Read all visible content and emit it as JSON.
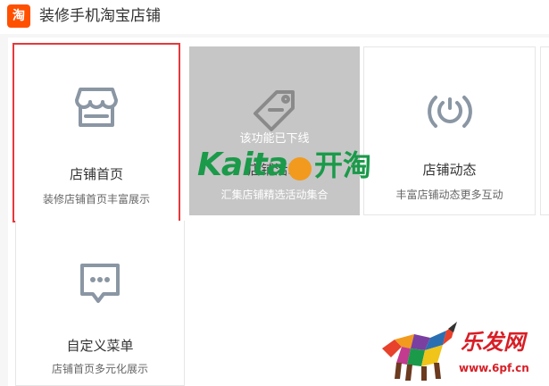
{
  "header": {
    "logo_text": "淘",
    "title": "装修手机淘宝店铺"
  },
  "tiles": [
    {
      "title": "店铺首页",
      "desc": "装修店铺首页丰富展示",
      "icon": "storefront-icon",
      "selected": true
    },
    {
      "title": "店铺活动",
      "desc": "汇集店铺精选活动集合",
      "icon": "price-tag-icon",
      "disabled": true,
      "overlay": "该功能已下线"
    },
    {
      "title": "店铺动态",
      "desc": "丰富店铺动态更多互动",
      "icon": "broadcast-icon"
    },
    {
      "title": "自定义菜单",
      "desc": "店铺首页多元化展示",
      "icon": "chat-bubble-icon"
    }
  ],
  "watermark": {
    "latin_a": "Kaita",
    "cn": "开淘"
  },
  "brand": {
    "cn": "乐发网",
    "url": "www.6pf.cn"
  },
  "colors": {
    "accent": "#ff5000",
    "selected_border": "#e4393c",
    "icon": "#8a96a3"
  }
}
